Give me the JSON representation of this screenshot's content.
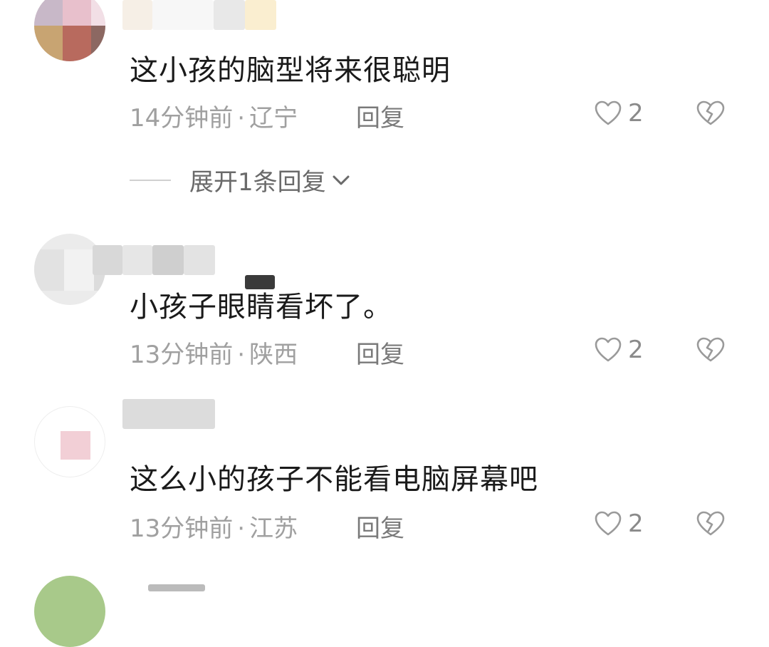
{
  "comments": [
    {
      "text": "这小孩的脑型将来很聪明",
      "time": "14分钟前",
      "location": "辽宁",
      "reply_label": "回复",
      "likes": "2",
      "expand_label": "展开1条回复"
    },
    {
      "text": "小孩子眼睛看坏了。",
      "time": "13分钟前",
      "location": "陕西",
      "reply_label": "回复",
      "likes": "2"
    },
    {
      "text": "这么小的孩子不能看电脑屏幕吧",
      "time": "13分钟前",
      "location": "江苏",
      "reply_label": "回复",
      "likes": "2"
    }
  ],
  "icons": {
    "like": "heart-outline-icon",
    "dislike": "broken-heart-icon",
    "expand": "chevron-down-icon"
  },
  "colors": {
    "text": "#1a1a1a",
    "meta": "#a0a0a0",
    "icon": "#9a9a9a"
  }
}
